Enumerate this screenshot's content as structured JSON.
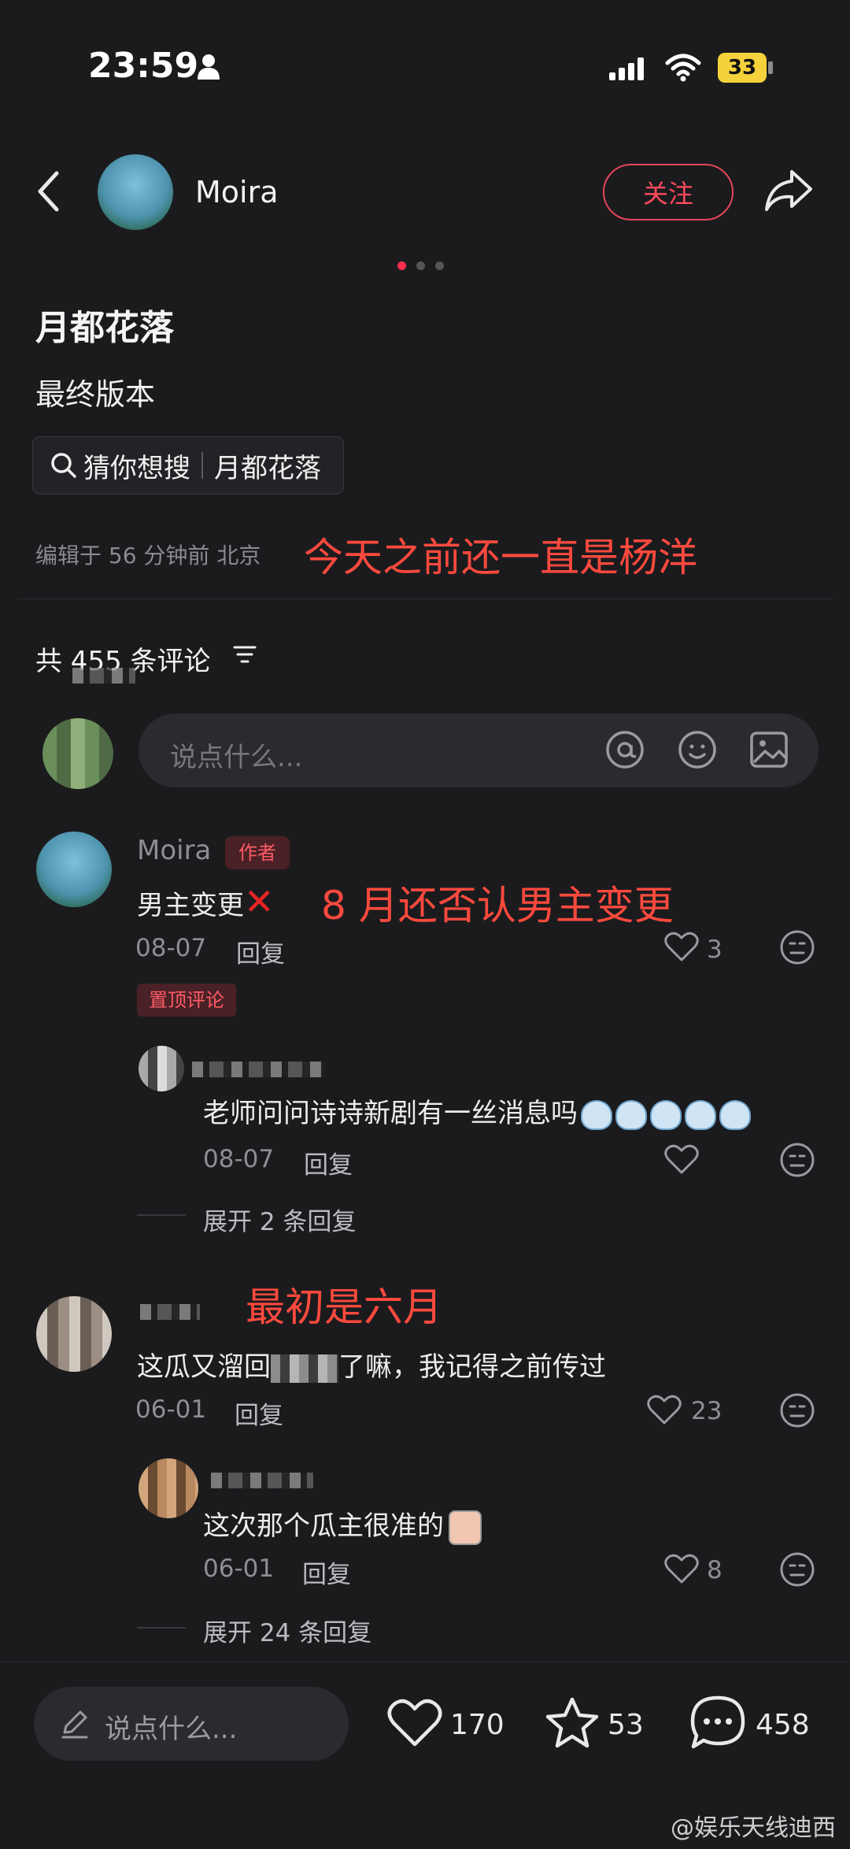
{
  "status_bar": {
    "time": "23:59",
    "battery": "33"
  },
  "header": {
    "author": "Moira",
    "follow_label": "关注"
  },
  "post": {
    "title": "月都花落",
    "description": "最终版本",
    "search_prefix": "猜你想搜",
    "search_term": "月都花落",
    "meta": "编辑于 56 分钟前 北京",
    "annotation": "今天之前还一直是杨洋"
  },
  "comments_header": {
    "count_label": "共 455 条评论"
  },
  "comment_input": {
    "placeholder": "说点什么..."
  },
  "comments": [
    {
      "name": "Moira",
      "badge": "作者",
      "text": "男主变更",
      "annotation": "8 月还否认男主变更",
      "date": "08-07",
      "reply": "回复",
      "likes": "3",
      "pinned_label": "置顶评论"
    },
    {
      "text": "老师问问诗诗新剧有一丝消息吗",
      "date": "08-07",
      "reply": "回复",
      "expand": "展开 2 条回复"
    },
    {
      "annotation": "最初是六月",
      "text_before": "这瓜又溜回",
      "text_after": "了嘛，我记得之前传过",
      "date": "06-01",
      "reply": "回复",
      "likes": "23"
    },
    {
      "text": "这次那个瓜主很准的",
      "date": "06-01",
      "reply": "回复",
      "likes": "8",
      "expand": "展开 24 条回复"
    }
  ],
  "bottom_bar": {
    "placeholder": "说点什么...",
    "likes": "170",
    "favorites": "53",
    "comments": "458"
  },
  "watermark": "@娱乐天线迪西",
  "colors": {
    "accent": "#ff2e4d",
    "annotation": "#ff4a3d",
    "background": "#1b1b1e"
  }
}
